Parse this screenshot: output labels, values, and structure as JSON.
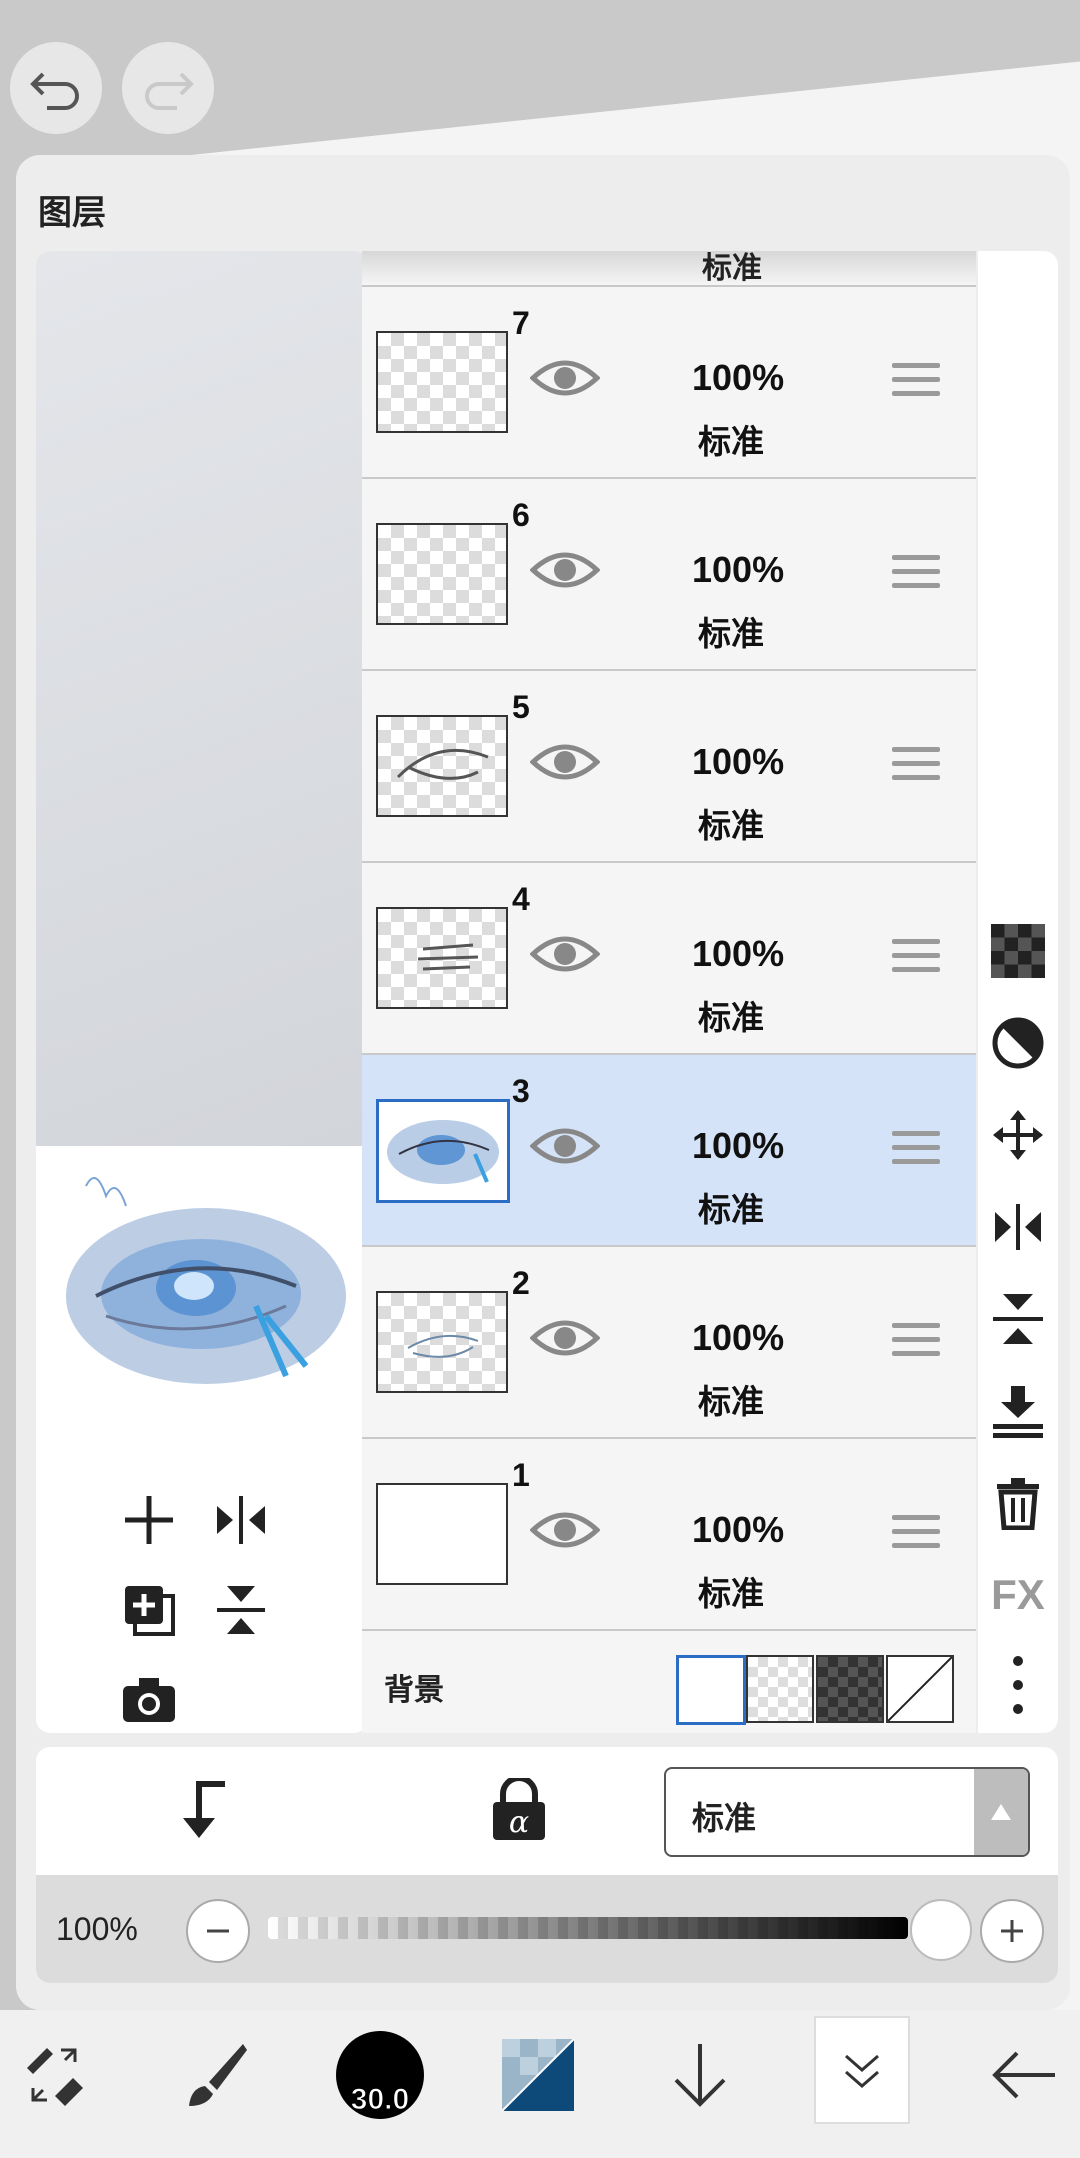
{
  "panel": {
    "title": "图层"
  },
  "history": {
    "undo_icon": "undo-icon",
    "redo_icon": "redo-icon"
  },
  "layers": {
    "top_partial_blend": "标准",
    "rows": [
      {
        "num": "7",
        "opacity": "100%",
        "blend": "标准"
      },
      {
        "num": "6",
        "opacity": "100%",
        "blend": "标准"
      },
      {
        "num": "5",
        "opacity": "100%",
        "blend": "标准"
      },
      {
        "num": "4",
        "opacity": "100%",
        "blend": "标准"
      },
      {
        "num": "3",
        "opacity": "100%",
        "blend": "标准",
        "selected": true
      },
      {
        "num": "2",
        "opacity": "100%",
        "blend": "标准"
      },
      {
        "num": "1",
        "opacity": "100%",
        "blend": "标准"
      }
    ],
    "background_label": "背景"
  },
  "side_tools": {
    "fx_label": "FX"
  },
  "blend_mode": {
    "selected": "标准"
  },
  "opacity": {
    "label": "100%",
    "value_fraction": 1.0
  },
  "toolbar": {
    "brush_size": "30.0"
  },
  "colors": {
    "selected_row": "#d4e3f7",
    "selected_border": "#2b6cc4"
  }
}
